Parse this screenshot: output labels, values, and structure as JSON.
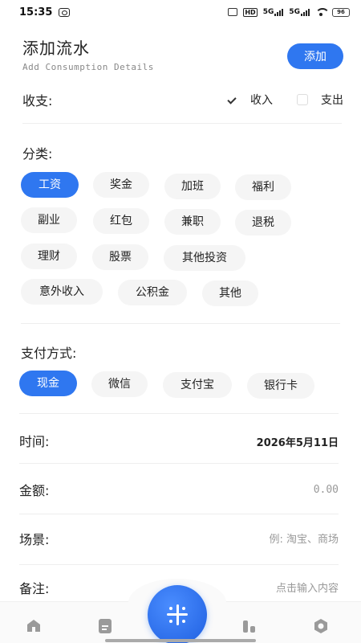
{
  "status_bar": {
    "time": "15:35",
    "hd_label": "HD",
    "network_1": "5G",
    "network_2": "5G",
    "battery": "96"
  },
  "header": {
    "title": "添加流水",
    "subtitle": "Add Consumption Details",
    "add_label": "添加"
  },
  "type": {
    "label": "收支:",
    "options": [
      {
        "label": "收入",
        "checked": true
      },
      {
        "label": "支出",
        "checked": false
      }
    ]
  },
  "category": {
    "label": "分类:",
    "selected": "工资",
    "items": [
      "工资",
      "奖金",
      "加班",
      "福利",
      "副业",
      "红包",
      "兼职",
      "退税",
      "理财",
      "股票",
      "其他投资",
      "意外收入",
      "公积金",
      "其他"
    ]
  },
  "payment": {
    "label": "支付方式:",
    "selected": "现金",
    "items": [
      "现金",
      "微信",
      "支付宝",
      "银行卡"
    ]
  },
  "form": {
    "time_label": "时间:",
    "time_value": "2026年5月11日",
    "amount_label": "金额:",
    "amount_value": "0.00",
    "scene_label": "场景:",
    "scene_placeholder": "例: 淘宝、商场",
    "note_label": "备注:",
    "note_placeholder": "点击输入内容"
  },
  "nav": {
    "items": [
      "home-icon",
      "document-icon",
      "add-icon",
      "chart-icon",
      "settings-icon"
    ]
  },
  "colors": {
    "accent": "#2f77f0",
    "chip_bg": "#f5f5f5"
  }
}
